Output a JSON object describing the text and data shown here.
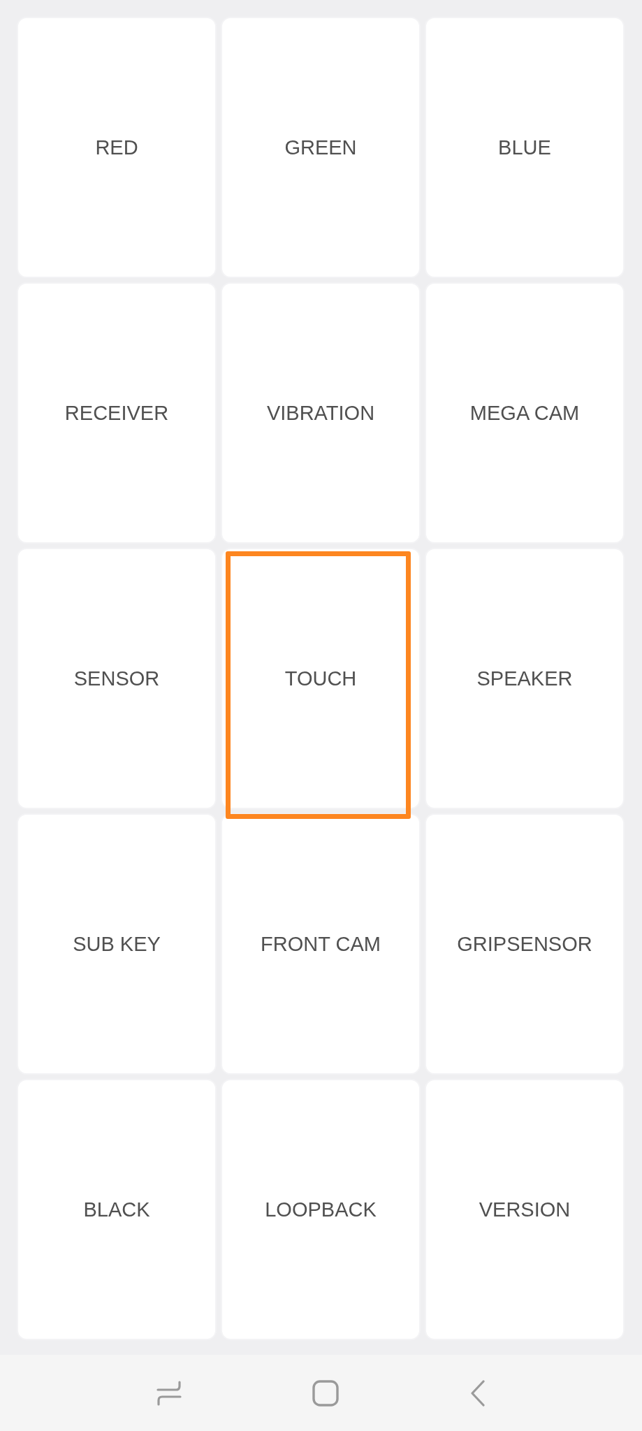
{
  "tiles": [
    {
      "label": "RED",
      "selected": false
    },
    {
      "label": "GREEN",
      "selected": false
    },
    {
      "label": "BLUE",
      "selected": false
    },
    {
      "label": "RECEIVER",
      "selected": false
    },
    {
      "label": "VIBRATION",
      "selected": false
    },
    {
      "label": "MEGA CAM",
      "selected": false
    },
    {
      "label": "SENSOR",
      "selected": false
    },
    {
      "label": "TOUCH",
      "selected": true
    },
    {
      "label": "SPEAKER",
      "selected": false
    },
    {
      "label": "SUB KEY",
      "selected": false
    },
    {
      "label": "FRONT CAM",
      "selected": false
    },
    {
      "label": "GRIPSENSOR",
      "selected": false
    },
    {
      "label": "BLACK",
      "selected": false
    },
    {
      "label": "LOOPBACK",
      "selected": false
    },
    {
      "label": "VERSION",
      "selected": false
    }
  ]
}
